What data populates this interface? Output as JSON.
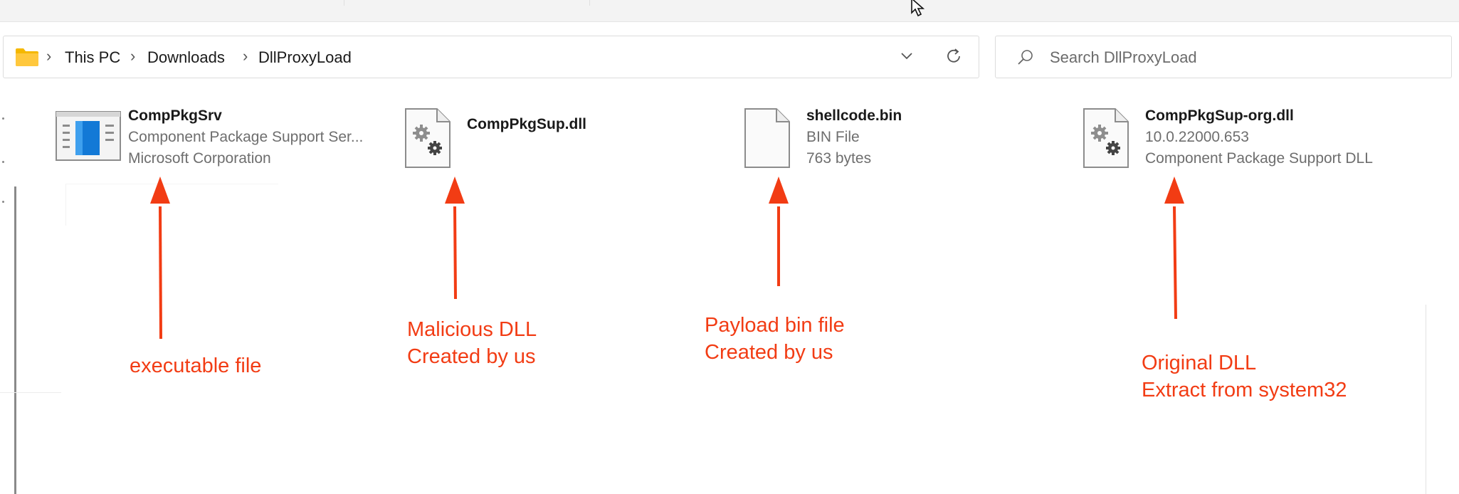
{
  "breadcrumb": {
    "items": [
      "This PC",
      "Downloads",
      "DllProxyLoad"
    ]
  },
  "search": {
    "placeholder": "Search DllProxyLoad"
  },
  "files": [
    {
      "name": "CompPkgSrv",
      "line1": "Component Package Support Ser...",
      "line2": "Microsoft Corporation",
      "icon": "application-icon"
    },
    {
      "name": "CompPkgSup.dll",
      "line1": "",
      "line2": "",
      "icon": "dll-gear-icon"
    },
    {
      "name": "shellcode.bin",
      "line1": "BIN File",
      "line2": "763 bytes",
      "icon": "blank-file-icon"
    },
    {
      "name": "CompPkgSup-org.dll",
      "line1": "10.0.22000.653",
      "line2": "Component Package Support DLL",
      "icon": "dll-gear-icon"
    }
  ],
  "annotations": [
    {
      "line1": "executable file",
      "line2": ""
    },
    {
      "line1": "Malicious DLL",
      "line2": "Created by us"
    },
    {
      "line1": "Payload bin file",
      "line2": "Created by us"
    },
    {
      "line1": "Original DLL",
      "line2": "Extract from system32"
    }
  ],
  "colors": {
    "annotation": "#f23c14",
    "folder": "#f5b800",
    "app_blue": "#1379d6"
  }
}
